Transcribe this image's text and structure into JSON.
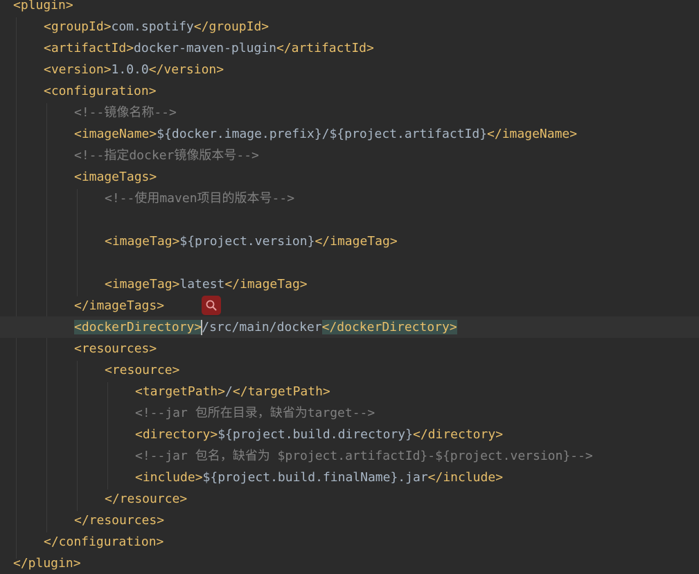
{
  "editor": {
    "lines": [
      {
        "id": "plugin-open",
        "parts": [
          {
            "t": "tag",
            "v": "<plugin>"
          }
        ]
      },
      {
        "id": "group-id",
        "parts": [
          {
            "t": "tag",
            "v": "<groupId>"
          },
          {
            "t": "txt",
            "v": "com.spotify"
          },
          {
            "t": "tag",
            "v": "</groupId>"
          }
        ]
      },
      {
        "id": "artifact-id",
        "parts": [
          {
            "t": "tag",
            "v": "<artifactId>"
          },
          {
            "t": "txt",
            "v": "docker-maven-plugin"
          },
          {
            "t": "tag",
            "v": "</artifactId>"
          }
        ]
      },
      {
        "id": "version",
        "parts": [
          {
            "t": "tag",
            "v": "<version>"
          },
          {
            "t": "txt",
            "v": "1.0.0"
          },
          {
            "t": "tag",
            "v": "</version>"
          }
        ]
      },
      {
        "id": "configuration-open",
        "parts": [
          {
            "t": "tag",
            "v": "<configuration>"
          }
        ]
      },
      {
        "id": "comment-image-name",
        "parts": [
          {
            "t": "cmt",
            "v": "<!--镜像名称-->"
          }
        ]
      },
      {
        "id": "image-name",
        "parts": [
          {
            "t": "tag",
            "v": "<imageName>"
          },
          {
            "t": "txt",
            "v": "${docker.image.prefix}/${project.artifactId}"
          },
          {
            "t": "tag",
            "v": "</imageName>"
          }
        ]
      },
      {
        "id": "comment-docker-version",
        "parts": [
          {
            "t": "cmt",
            "v": "<!--指定docker镜像版本号-->"
          }
        ]
      },
      {
        "id": "image-tags-open",
        "parts": [
          {
            "t": "tag",
            "v": "<imageTags>"
          }
        ]
      },
      {
        "id": "comment-maven-version",
        "parts": [
          {
            "t": "cmt",
            "v": "<!--使用maven项目的版本号-->"
          }
        ]
      },
      {
        "id": "blank-1",
        "parts": []
      },
      {
        "id": "image-tag-version",
        "parts": [
          {
            "t": "tag",
            "v": "<imageTag>"
          },
          {
            "t": "txt",
            "v": "${project.version}"
          },
          {
            "t": "tag",
            "v": "</imageTag>"
          }
        ]
      },
      {
        "id": "blank-2",
        "parts": []
      },
      {
        "id": "image-tag-latest",
        "parts": [
          {
            "t": "tag",
            "v": "<imageTag>"
          },
          {
            "t": "txt",
            "v": "latest"
          },
          {
            "t": "tag",
            "v": "</imageTag>"
          }
        ]
      },
      {
        "id": "image-tags-close",
        "parts": [
          {
            "t": "tag",
            "v": "</imageTags>"
          }
        ]
      },
      {
        "id": "docker-directory",
        "parts": [
          {
            "t": "tag",
            "v": "<dockerDirectory>",
            "hl": true
          },
          {
            "t": "caret",
            "v": ""
          },
          {
            "t": "txt",
            "v": "/src/main/docker"
          },
          {
            "t": "tag",
            "v": "</dockerDirectory>",
            "hl": true
          }
        ]
      },
      {
        "id": "resources-open",
        "parts": [
          {
            "t": "tag",
            "v": "<resources>"
          }
        ]
      },
      {
        "id": "resource-open",
        "parts": [
          {
            "t": "tag",
            "v": "<resource>"
          }
        ]
      },
      {
        "id": "target-path",
        "parts": [
          {
            "t": "tag",
            "v": "<targetPath>"
          },
          {
            "t": "txt",
            "v": "/"
          },
          {
            "t": "tag",
            "v": "</targetPath>"
          }
        ]
      },
      {
        "id": "comment-jar-dir",
        "parts": [
          {
            "t": "cmt",
            "v": "<!--jar 包所在目录，缺省为target-->"
          }
        ]
      },
      {
        "id": "directory",
        "parts": [
          {
            "t": "tag",
            "v": "<directory>"
          },
          {
            "t": "txt",
            "v": "${project.build.directory}"
          },
          {
            "t": "tag",
            "v": "</directory>"
          }
        ]
      },
      {
        "id": "comment-jar-name",
        "parts": [
          {
            "t": "cmt",
            "v": "<!--jar 包名，缺省为 $project.artifactId}-${project.version}-->"
          }
        ]
      },
      {
        "id": "include",
        "parts": [
          {
            "t": "tag",
            "v": "<include>"
          },
          {
            "t": "txt",
            "v": "${project.build.finalName}.jar"
          },
          {
            "t": "tag",
            "v": "</include>"
          }
        ]
      },
      {
        "id": "resource-close",
        "parts": [
          {
            "t": "tag",
            "v": "</resource>"
          }
        ]
      },
      {
        "id": "resources-close",
        "parts": [
          {
            "t": "tag",
            "v": "</resources>"
          }
        ]
      },
      {
        "id": "configuration-close",
        "parts": [
          {
            "t": "tag",
            "v": "</configuration>"
          }
        ]
      },
      {
        "id": "plugin-close",
        "parts": [
          {
            "t": "tag",
            "v": "</plugin>"
          }
        ]
      }
    ]
  },
  "search_badge": {
    "icon": "search-icon",
    "color": "#8a1f1f"
  },
  "colors": {
    "background": "#2b2b2b",
    "tag": "#e8bf6a",
    "text": "#a9b7c6",
    "comment": "#808080",
    "match_highlight": "#3b514d",
    "current_line": "#323232"
  }
}
